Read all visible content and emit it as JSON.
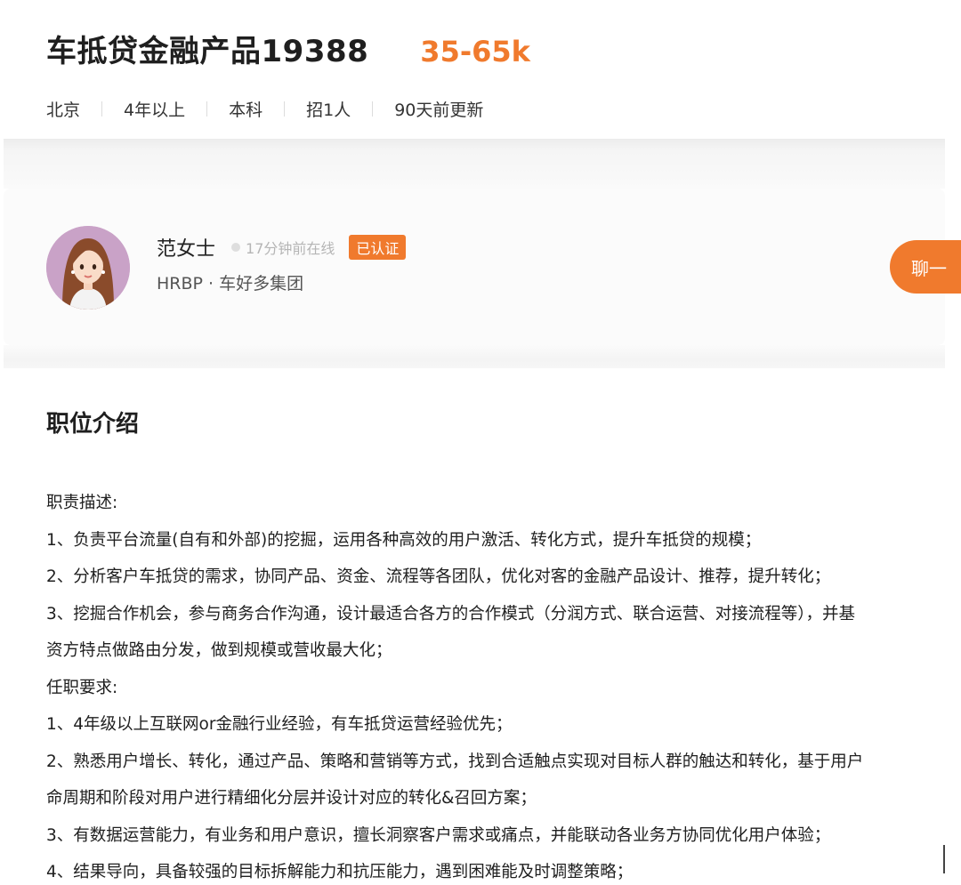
{
  "job": {
    "title": "车抵贷金融产品19388",
    "salary": "35-65k",
    "meta": [
      "北京",
      "4年以上",
      "本科",
      "招1人",
      "90天前更新"
    ]
  },
  "recruiter": {
    "name": "范女士",
    "online_status": "17分钟前在线",
    "verified_badge": "已认证",
    "title": "HRBP · 车好多集团",
    "chat_button": "聊一"
  },
  "description": {
    "section_title": "职位介绍",
    "lines": [
      "职责描述:",
      "1、负责平台流量(自有和外部)的挖掘，运用各种高效的用户激活、转化方式，提升车抵贷的规模；",
      "2、分析客户车抵贷的需求，协同产品、资金、流程等各团队，优化对客的金融产品设计、推荐，提升转化；",
      "3、挖掘合作机会，参与商务合作沟通，设计最适合各方的合作模式（分润方式、联合运营、对接流程等），并基",
      "资方特点做路由分发，做到规模或营收最大化；",
      "任职要求:",
      "1、4年级以上互联网or金融行业经验，有车抵贷运营经验优先；",
      "2、熟悉用户增长、转化，通过产品、策略和营销等方式，找到合适触点实现对目标人群的触达和转化，基于用户",
      "命周期和阶段对用户进行精细化分层并设计对应的转化&召回方案；",
      "3、有数据运营能力，有业务和用户意识，擅长洞察客户需求或痛点，并能联动各业务方协同优化用户体验；",
      "4、结果导向，具备较强的目标拆解能力和抗压能力，遇到困难能及时调整策略；"
    ]
  },
  "colors": {
    "accent": "#f07a2d",
    "text_primary": "#1f1f1f",
    "text_muted": "#b5b5b5"
  }
}
